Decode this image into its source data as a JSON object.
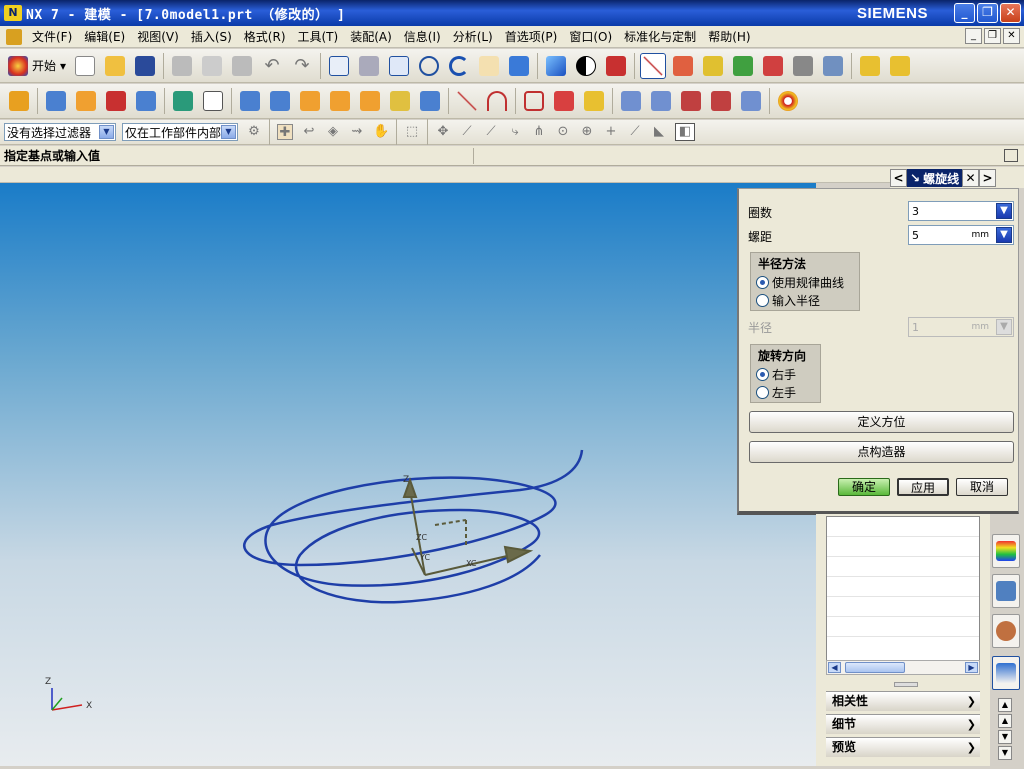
{
  "window": {
    "title": "NX 7 - 建模 - [7.0model1.prt （修改的） ]",
    "brand": "SIEMENS"
  },
  "menu": {
    "items": [
      "文件(F)",
      "编辑(E)",
      "视图(V)",
      "插入(S)",
      "格式(R)",
      "工具(T)",
      "装配(A)",
      "信息(I)",
      "分析(L)",
      "首选项(P)",
      "窗口(O)",
      "标准化与定制",
      "帮助(H)"
    ]
  },
  "toolbar": {
    "start_label": "开始"
  },
  "filters": {
    "type_filter": "没有选择过滤器",
    "scope_filter": "仅在工作部件内部"
  },
  "cue": {
    "text": "指定基点或输入值"
  },
  "panel": {
    "title": "螺旋线"
  },
  "dialog": {
    "turns_label": "圈数",
    "turns_value": "3",
    "pitch_label": "螺距",
    "pitch_value": "5",
    "pitch_unit": "mm",
    "radius_method": {
      "title": "半径方法",
      "options": [
        "使用规律曲线",
        "输入半径"
      ],
      "selected": 0
    },
    "radius_label": "半径",
    "radius_value": "1",
    "radius_unit": "mm",
    "rotation": {
      "title": "旋转方向",
      "options": [
        "右手",
        "左手"
      ],
      "selected": 0
    },
    "define_orientation": "定义方位",
    "point_constructor": "点构造器",
    "ok": "确定",
    "apply": "应用",
    "cancel": "取消"
  },
  "resource": {
    "sections": [
      "相关性",
      "细节",
      "预览"
    ]
  },
  "axes": {
    "z": "Z",
    "x": "X",
    "zc": "ZC",
    "yc": "YC",
    "xc": "XC"
  }
}
